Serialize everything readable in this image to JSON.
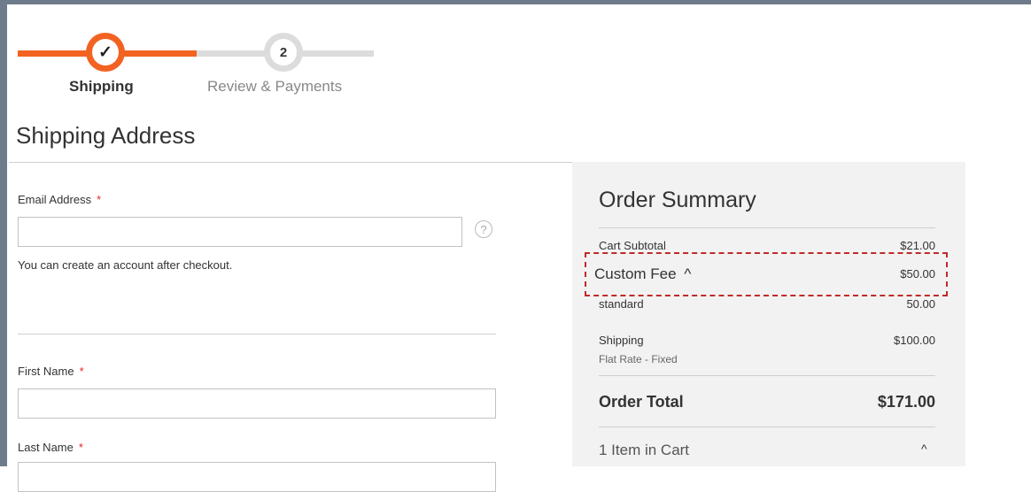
{
  "progress": {
    "step1": {
      "icon": "✓",
      "label": "Shipping"
    },
    "step2": {
      "number": "2",
      "label": "Review & Payments"
    }
  },
  "page": {
    "title": "Shipping Address"
  },
  "form": {
    "email": {
      "label": "Email Address",
      "required": "*",
      "value": "",
      "help_icon": "?",
      "note": "You can create an account after checkout."
    },
    "first_name": {
      "label": "First Name",
      "required": "*",
      "value": ""
    },
    "last_name": {
      "label": "Last Name",
      "required": "*",
      "value": ""
    }
  },
  "summary": {
    "title": "Order Summary",
    "cart_subtotal": {
      "label": "Cart Subtotal",
      "value": "$21.00"
    },
    "custom_fee": {
      "label": "Custom Fee",
      "toggle": "^",
      "value": "$50.00"
    },
    "standard": {
      "label": "standard",
      "value": "50.00"
    },
    "shipping": {
      "label": "Shipping",
      "method": "Flat Rate - Fixed",
      "value": "$100.00"
    },
    "order_total": {
      "label": "Order Total",
      "value": "$171.00"
    },
    "items": {
      "label": "1 Item in Cart",
      "toggle": "^"
    }
  },
  "colors": {
    "accent": "#f26322",
    "highlight_dash": "#c12a2a",
    "required": "#e02b27",
    "frame": "#6e7b8a"
  }
}
